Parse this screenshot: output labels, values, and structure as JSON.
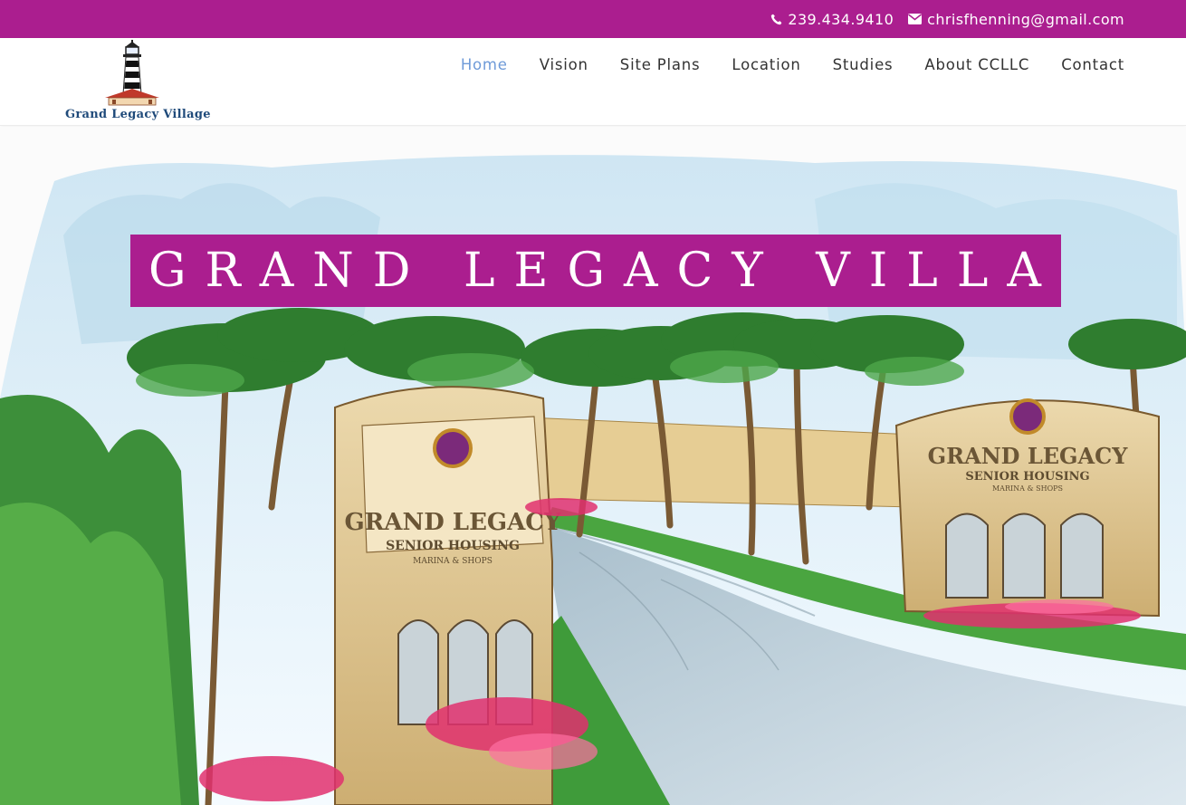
{
  "topbar": {
    "phone": "239.434.9410",
    "phone_icon": "phone-icon",
    "email": "chrisfhenning@gmail.com",
    "email_icon": "envelope-icon",
    "background": "#ab1e8f"
  },
  "logo": {
    "text": "Grand Legacy Village",
    "icon": "lighthouse-icon"
  },
  "nav": {
    "items": [
      {
        "label": "Home",
        "active": true
      },
      {
        "label": "Vision",
        "active": false
      },
      {
        "label": "Site Plans",
        "active": false
      },
      {
        "label": "Location",
        "active": false
      },
      {
        "label": "Studies",
        "active": false
      },
      {
        "label": "About CCLLC",
        "active": false
      },
      {
        "label": "Contact",
        "active": false
      }
    ],
    "active_color": "#6e9ad8"
  },
  "hero": {
    "title": "GRAND LEGACY VILLAGE",
    "sign_left": {
      "line1": "GRAND LEGACY",
      "line2": "SENIOR HOUSING",
      "line3": "MARINA & SHOPS"
    },
    "sign_right": {
      "line1": "GRAND LEGACY",
      "line2": "SENIOR HOUSING",
      "line3": "MARINA & SHOPS"
    }
  }
}
